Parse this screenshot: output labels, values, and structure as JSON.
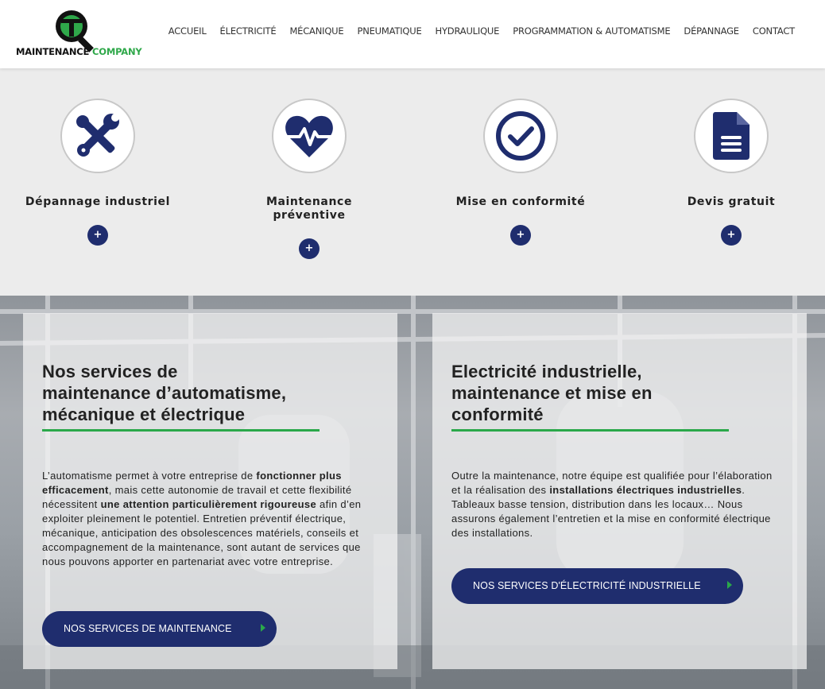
{
  "logo": {
    "word1": "MAINTENANCE",
    "word2": "COMPANY"
  },
  "nav": [
    "ACCUEIL",
    "ÉLECTRICITÉ",
    "MÉCANIQUE",
    "PNEUMATIQUE",
    "HYDRAULIQUE",
    "PROGRAMMATION & AUTOMATISME",
    "DÉPANNAGE",
    "CONTACT"
  ],
  "services": [
    {
      "title": "Dépannage industriel",
      "icon": "tools-icon",
      "plus": "+"
    },
    {
      "title_l1": "Maintenance",
      "title_l2": "préventive",
      "icon": "heartbeat-icon",
      "plus": "+"
    },
    {
      "title": "Mise en conformité",
      "icon": "check-circle-icon",
      "plus": "+"
    },
    {
      "title": "Devis gratuit",
      "icon": "document-icon",
      "plus": "+"
    }
  ],
  "panel1": {
    "title_l1": "Nos services de",
    "title_l2": "maintenance d’automatisme,",
    "title_l3": "mécanique et électrique",
    "p_a": "L’automatisme permet à votre entreprise de ",
    "p_b": "fonctionner plus efficacement",
    "p_c": ", mais cette autonomie de travail et cette flexibilité nécessitent ",
    "p_d": "une attention particulièrement rigoureuse",
    "p_e": " afin d’en exploiter pleinement le potentiel. Entretien préventif électrique, mécanique, anticipation des obsolescences matériels, conseils et accompagnement de la maintenance, sont autant de services que nous pouvons apporter en partenariat avec votre entreprise.",
    "button": "NOS SERVICES DE MAINTENANCE"
  },
  "panel2": {
    "title_l1": "Electricité industrielle,",
    "title_l2": "maintenance et mise en",
    "title_l3": "conformité",
    "p_a": "Outre la maintenance, notre équipe est qualifiée pour l’élaboration et la réalisation des ",
    "p_b": "installations électriques industrielles",
    "p_c": ". Tableaux basse tension, distribution dans les locaux… Nous assurons également l’entretien et la mise en conformité électrique des installations.",
    "button": "NOS SERVICES D'ÉLECTRICITÉ INDUSTRIELLE"
  },
  "colors": {
    "navy": "#1f2d6e",
    "green": "#2aa84a",
    "band": "#ececec"
  }
}
